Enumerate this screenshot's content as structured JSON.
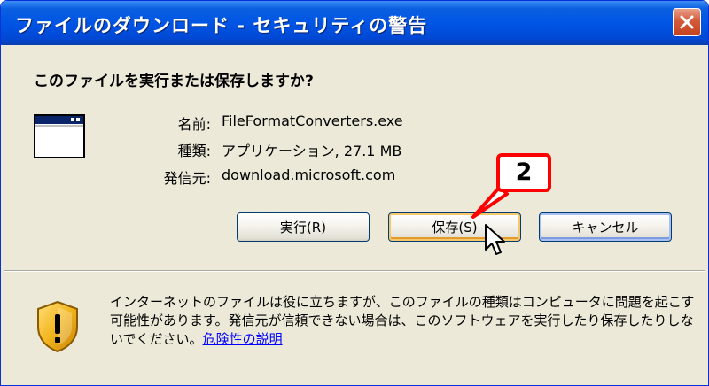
{
  "window": {
    "title": "ファイルのダウンロード - セキュリティの警告"
  },
  "dialog": {
    "question": "このファイルを実行または保存しますか?",
    "fields": [
      {
        "label": "名前:",
        "value": "FileFormatConverters.exe"
      },
      {
        "label": "種類:",
        "value": "アプリケーション, 27.1 MB"
      },
      {
        "label": "発信元:",
        "value": "download.microsoft.com"
      }
    ],
    "buttons": {
      "run": "実行(R)",
      "save": "保存(S)",
      "cancel": "キャンセル"
    }
  },
  "warning": {
    "text": "インターネットのファイルは役に立ちますが、このファイルの種類はコンピュータに問題を起こす可能性があります。発信元が信頼できない場合は、このソフトウェアを実行したり保存したりしないでください。",
    "link": "危険性の説明"
  },
  "annotation": {
    "step": "2"
  },
  "colors": {
    "titlebar": "#0055e5",
    "dialog_bg": "#ece9d8",
    "callout_border": "#ff0000",
    "link": "#0000ff"
  }
}
